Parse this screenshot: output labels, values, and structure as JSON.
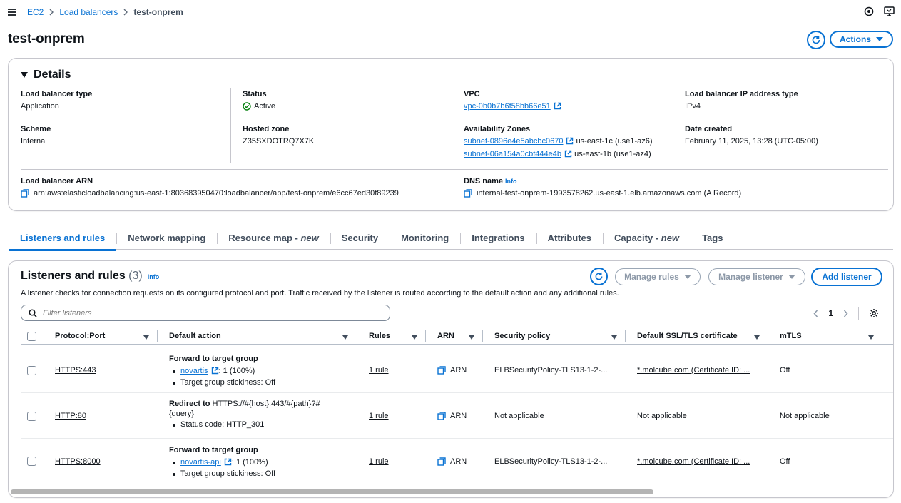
{
  "breadcrumb": {
    "items": [
      "EC2",
      "Load balancers"
    ],
    "current": "test-onprem"
  },
  "page": {
    "title": "test-onprem",
    "actions_label": "Actions"
  },
  "details": {
    "heading": "Details",
    "lb_type_label": "Load balancer type",
    "lb_type": "Application",
    "scheme_label": "Scheme",
    "scheme": "Internal",
    "status_label": "Status",
    "status": "Active",
    "hosted_zone_label": "Hosted zone",
    "hosted_zone": "Z35SXDOTRQ7X7K",
    "vpc_label": "VPC",
    "vpc": "vpc-0b0b7b6f58bb66e51",
    "az_label": "Availability Zones",
    "az": [
      {
        "subnet": "subnet-0896e4e5abcbc0670",
        "zone": "us-east-1c (use1-az6)"
      },
      {
        "subnet": "subnet-06a154a0cbf444e4b",
        "zone": "us-east-1b (use1-az4)"
      }
    ],
    "ip_type_label": "Load balancer IP address type",
    "ip_type": "IPv4",
    "date_label": "Date created",
    "date": "February 11, 2025, 13:28 (UTC-05:00)",
    "arn_label": "Load balancer ARN",
    "arn": "arn:aws:elasticloadbalancing:us-east-1:803683950470:loadbalancer/app/test-onprem/e6cc67ed30f89239",
    "dns_label": "DNS name",
    "dns_info": "Info",
    "dns": "internal-test-onprem-1993578262.us-east-1.elb.amazonaws.com (A Record)"
  },
  "tabs": [
    {
      "label": "Listeners and rules",
      "suffix": ""
    },
    {
      "label": "Network mapping",
      "suffix": ""
    },
    {
      "label": "Resource map - ",
      "suffix": "new"
    },
    {
      "label": "Security",
      "suffix": ""
    },
    {
      "label": "Monitoring",
      "suffix": ""
    },
    {
      "label": "Integrations",
      "suffix": ""
    },
    {
      "label": "Attributes",
      "suffix": ""
    },
    {
      "label": "Capacity - ",
      "suffix": "new"
    },
    {
      "label": "Tags",
      "suffix": ""
    }
  ],
  "listeners": {
    "title": "Listeners and rules",
    "count": "(3)",
    "info": "Info",
    "manage_rules": "Manage rules",
    "manage_listener": "Manage listener",
    "add_listener": "Add listener",
    "description": "A listener checks for connection requests on its configured protocol and port. Traffic received by the listener is routed according to the default action and any additional rules.",
    "filter_placeholder": "Filter listeners",
    "page": "1",
    "columns": [
      "Protocol:Port",
      "Default action",
      "Rules",
      "ARN",
      "Security policy",
      "Default SSL/TLS certificate",
      "mTLS"
    ],
    "rows": [
      {
        "protocol": "HTTPS:443",
        "action_title": "Forward to target group",
        "target": "novartis",
        "target_weight": ": 1 (100%)",
        "stickiness": "Target group stickiness: Off",
        "rules": "1 rule",
        "arn": "ARN",
        "policy": "ELBSecurityPolicy-TLS13-1-2-...",
        "cert": "*.molcube.com (Certificate ID: ...",
        "mtls": "Off"
      },
      {
        "protocol": "HTTP:80",
        "action_title": "Redirect to",
        "redirect_target": " HTTPS://#{host}:443/#{path}?#",
        "redirect_query": "{query}",
        "status_code": "Status code: HTTP_301",
        "rules": "1 rule",
        "arn": "ARN",
        "policy": "Not applicable",
        "cert": "Not applicable",
        "mtls": "Not applicable"
      },
      {
        "protocol": "HTTPS:8000",
        "action_title": "Forward to target group",
        "target": "novartis-api",
        "target_weight": ": 1 (100%)",
        "stickiness": "Target group stickiness: Off",
        "rules": "1 rule",
        "arn": "ARN",
        "policy": "ELBSecurityPolicy-TLS13-1-2-...",
        "cert": "*.molcube.com (Certificate ID: ...",
        "mtls": "Off"
      }
    ]
  },
  "colors": {
    "link": "#0972d3",
    "success": "#037f0c",
    "border": "#c6c6cd"
  }
}
